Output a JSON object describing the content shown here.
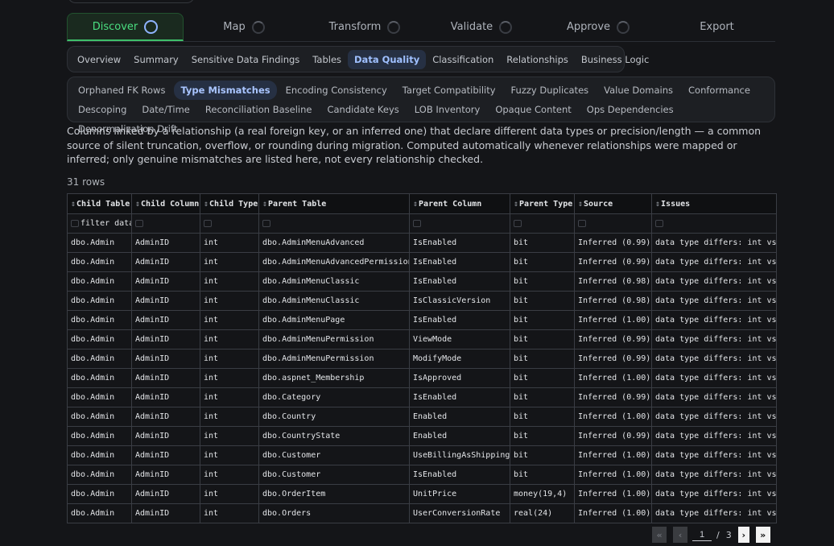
{
  "steps": [
    {
      "label": "Discover",
      "active": true
    },
    {
      "label": "Map",
      "active": false
    },
    {
      "label": "Transform",
      "active": false
    },
    {
      "label": "Validate",
      "active": false
    },
    {
      "label": "Approve",
      "active": false
    },
    {
      "label": "Export",
      "active": false
    }
  ],
  "subtabs": [
    "Overview",
    "Summary",
    "Sensitive Data Findings",
    "Tables",
    "Data Quality",
    "Classification",
    "Relationships",
    "Business Logic"
  ],
  "active_subtab": "Data Quality",
  "dq_tabs": [
    "Orphaned FK Rows",
    "Type Mismatches",
    "Encoding Consistency",
    "Target Compatibility",
    "Fuzzy Duplicates",
    "Value Domains",
    "Conformance",
    "Descoping",
    "Date/Time",
    "Reconciliation Baseline",
    "Candidate Keys",
    "LOB Inventory",
    "Opaque Content",
    "Ops Dependencies",
    "Denormalization Drift"
  ],
  "active_dq_tab": "Type Mismatches",
  "description": "Columns linked by a relationship (a real foreign key, or an inferred one) that declare different data types or precision/length — a common source of silent truncation, overflow, or rounding during migration. Computed automatically whenever relationships were mapped or inferred; only genuine mismatches are listed here, not every relationship checked.",
  "row_count": "31 rows",
  "columns": [
    "Child Table",
    "Child Column",
    "Child Type",
    "Parent Table",
    "Parent Column",
    "Parent Type",
    "Source",
    "Issues"
  ],
  "filter_placeholder": "filter data",
  "rows": [
    [
      "dbo.Admin",
      "AdminID",
      "int",
      "dbo.AdminMenuAdvanced",
      "IsEnabled",
      "bit",
      "Inferred (0.99)",
      "data type differs: int vs"
    ],
    [
      "dbo.Admin",
      "AdminID",
      "int",
      "dbo.AdminMenuAdvancedPermission",
      "IsEnabled",
      "bit",
      "Inferred (0.99)",
      "data type differs: int vs"
    ],
    [
      "dbo.Admin",
      "AdminID",
      "int",
      "dbo.AdminMenuClassic",
      "IsEnabled",
      "bit",
      "Inferred (0.98)",
      "data type differs: int vs"
    ],
    [
      "dbo.Admin",
      "AdminID",
      "int",
      "dbo.AdminMenuClassic",
      "IsClassicVersion",
      "bit",
      "Inferred (0.98)",
      "data type differs: int vs"
    ],
    [
      "dbo.Admin",
      "AdminID",
      "int",
      "dbo.AdminMenuPage",
      "IsEnabled",
      "bit",
      "Inferred (1.00)",
      "data type differs: int vs"
    ],
    [
      "dbo.Admin",
      "AdminID",
      "int",
      "dbo.AdminMenuPermission",
      "ViewMode",
      "bit",
      "Inferred (0.99)",
      "data type differs: int vs"
    ],
    [
      "dbo.Admin",
      "AdminID",
      "int",
      "dbo.AdminMenuPermission",
      "ModifyMode",
      "bit",
      "Inferred (0.99)",
      "data type differs: int vs"
    ],
    [
      "dbo.Admin",
      "AdminID",
      "int",
      "dbo.aspnet_Membership",
      "IsApproved",
      "bit",
      "Inferred (1.00)",
      "data type differs: int vs"
    ],
    [
      "dbo.Admin",
      "AdminID",
      "int",
      "dbo.Category",
      "IsEnabled",
      "bit",
      "Inferred (0.99)",
      "data type differs: int vs"
    ],
    [
      "dbo.Admin",
      "AdminID",
      "int",
      "dbo.Country",
      "Enabled",
      "bit",
      "Inferred (1.00)",
      "data type differs: int vs"
    ],
    [
      "dbo.Admin",
      "AdminID",
      "int",
      "dbo.CountryState",
      "Enabled",
      "bit",
      "Inferred (0.99)",
      "data type differs: int vs"
    ],
    [
      "dbo.Admin",
      "AdminID",
      "int",
      "dbo.Customer",
      "UseBillingAsShipping",
      "bit",
      "Inferred (1.00)",
      "data type differs: int vs"
    ],
    [
      "dbo.Admin",
      "AdminID",
      "int",
      "dbo.Customer",
      "IsEnabled",
      "bit",
      "Inferred (1.00)",
      "data type differs: int vs"
    ],
    [
      "dbo.Admin",
      "AdminID",
      "int",
      "dbo.OrderItem",
      "UnitPrice",
      "money(19,4)",
      "Inferred (1.00)",
      "data type differs: int vs"
    ],
    [
      "dbo.Admin",
      "AdminID",
      "int",
      "dbo.Orders",
      "UserConversionRate",
      "real(24)",
      "Inferred (1.00)",
      "data type differs: int vs"
    ]
  ],
  "pager": {
    "current": "1",
    "separator": "/",
    "total": "3",
    "first": "«",
    "prev": "‹",
    "next": "›",
    "last": "»"
  },
  "colors": {
    "accent_green": "#4ade80",
    "accent_blue": "#9fc0ff",
    "background": "#141518"
  }
}
